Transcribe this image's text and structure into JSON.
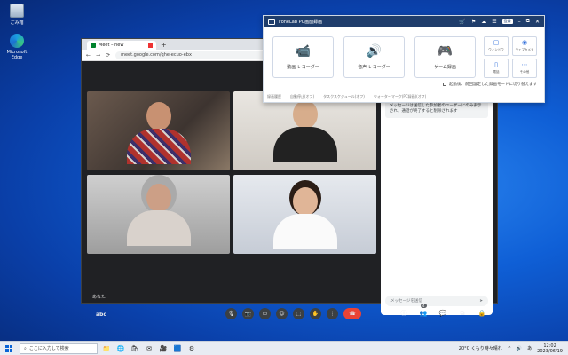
{
  "desktop": {
    "icons": [
      {
        "label": "ごみ箱",
        "icon": "recycle-bin-icon"
      },
      {
        "label": "Microsoft Edge",
        "icon": "edge-icon"
      }
    ]
  },
  "browser": {
    "tab_title": "Meet – new",
    "new_tab": "+",
    "address_url": "meet.google.com/qhe-ecuo-ebx",
    "window_controls": [
      "–",
      "□",
      "✕"
    ],
    "nav_controls": [
      "←",
      "→",
      "⟳"
    ]
  },
  "meet": {
    "self_name": "あなた",
    "meeting_code": "abc",
    "participants": 4,
    "controls": [
      "🎙",
      "📷",
      "▭",
      "☺",
      "⬚",
      "✋",
      "⋮"
    ],
    "end_call": "☎",
    "right_controls": [
      "ⓘ",
      "👥",
      "💬",
      "⧉",
      "🔒"
    ],
    "people_badge": "4",
    "chat_notice": "メッセージは送信した参加者のユーザーにのみ表示され、通話が終了すると削除されます",
    "chat_placeholder": "メッセージを送信",
    "send_icon": "➤"
  },
  "recorder": {
    "title": "FoneLab PC画面録画",
    "register": "登録",
    "title_icons": [
      "🛒",
      "⚑",
      "☁",
      "☰",
      "–",
      "⧉",
      "✕"
    ],
    "modes": [
      {
        "label": "動画 レコーダー",
        "icon": "video-camera-icon",
        "glyph": "📹"
      },
      {
        "label": "音声 レコーダー",
        "icon": "speaker-icon",
        "glyph": "🔊"
      },
      {
        "label": "ゲーム録画",
        "icon": "gamepad-icon",
        "glyph": "🎮"
      }
    ],
    "mini_tools": [
      {
        "label": "ウィンドウ",
        "glyph": "▢"
      },
      {
        "label": "ウェブカメラ",
        "glyph": "◉"
      },
      {
        "label": "電話",
        "glyph": "▯"
      },
      {
        "label": "その他",
        "glyph": "⋯"
      }
    ],
    "auto_note": "起動後、前回設定した録画モードに切り替えます",
    "footer_items": [
      "録画履歴",
      "自動停止(オフ)",
      "タスクスケジュール(オフ)",
      "ウォーターマーク(PC録画)(オフ)"
    ]
  },
  "taskbar": {
    "search_placeholder": "ここに入力して検索",
    "apps": [
      "📁",
      "🌐",
      "🛍",
      "✉",
      "🎥",
      "🟦",
      "⚙"
    ],
    "weather": "20°C くもり時々晴れ",
    "time": "12:02",
    "date": "2023/06/19",
    "tray_icons": [
      "^",
      "🔊",
      "あ"
    ]
  }
}
